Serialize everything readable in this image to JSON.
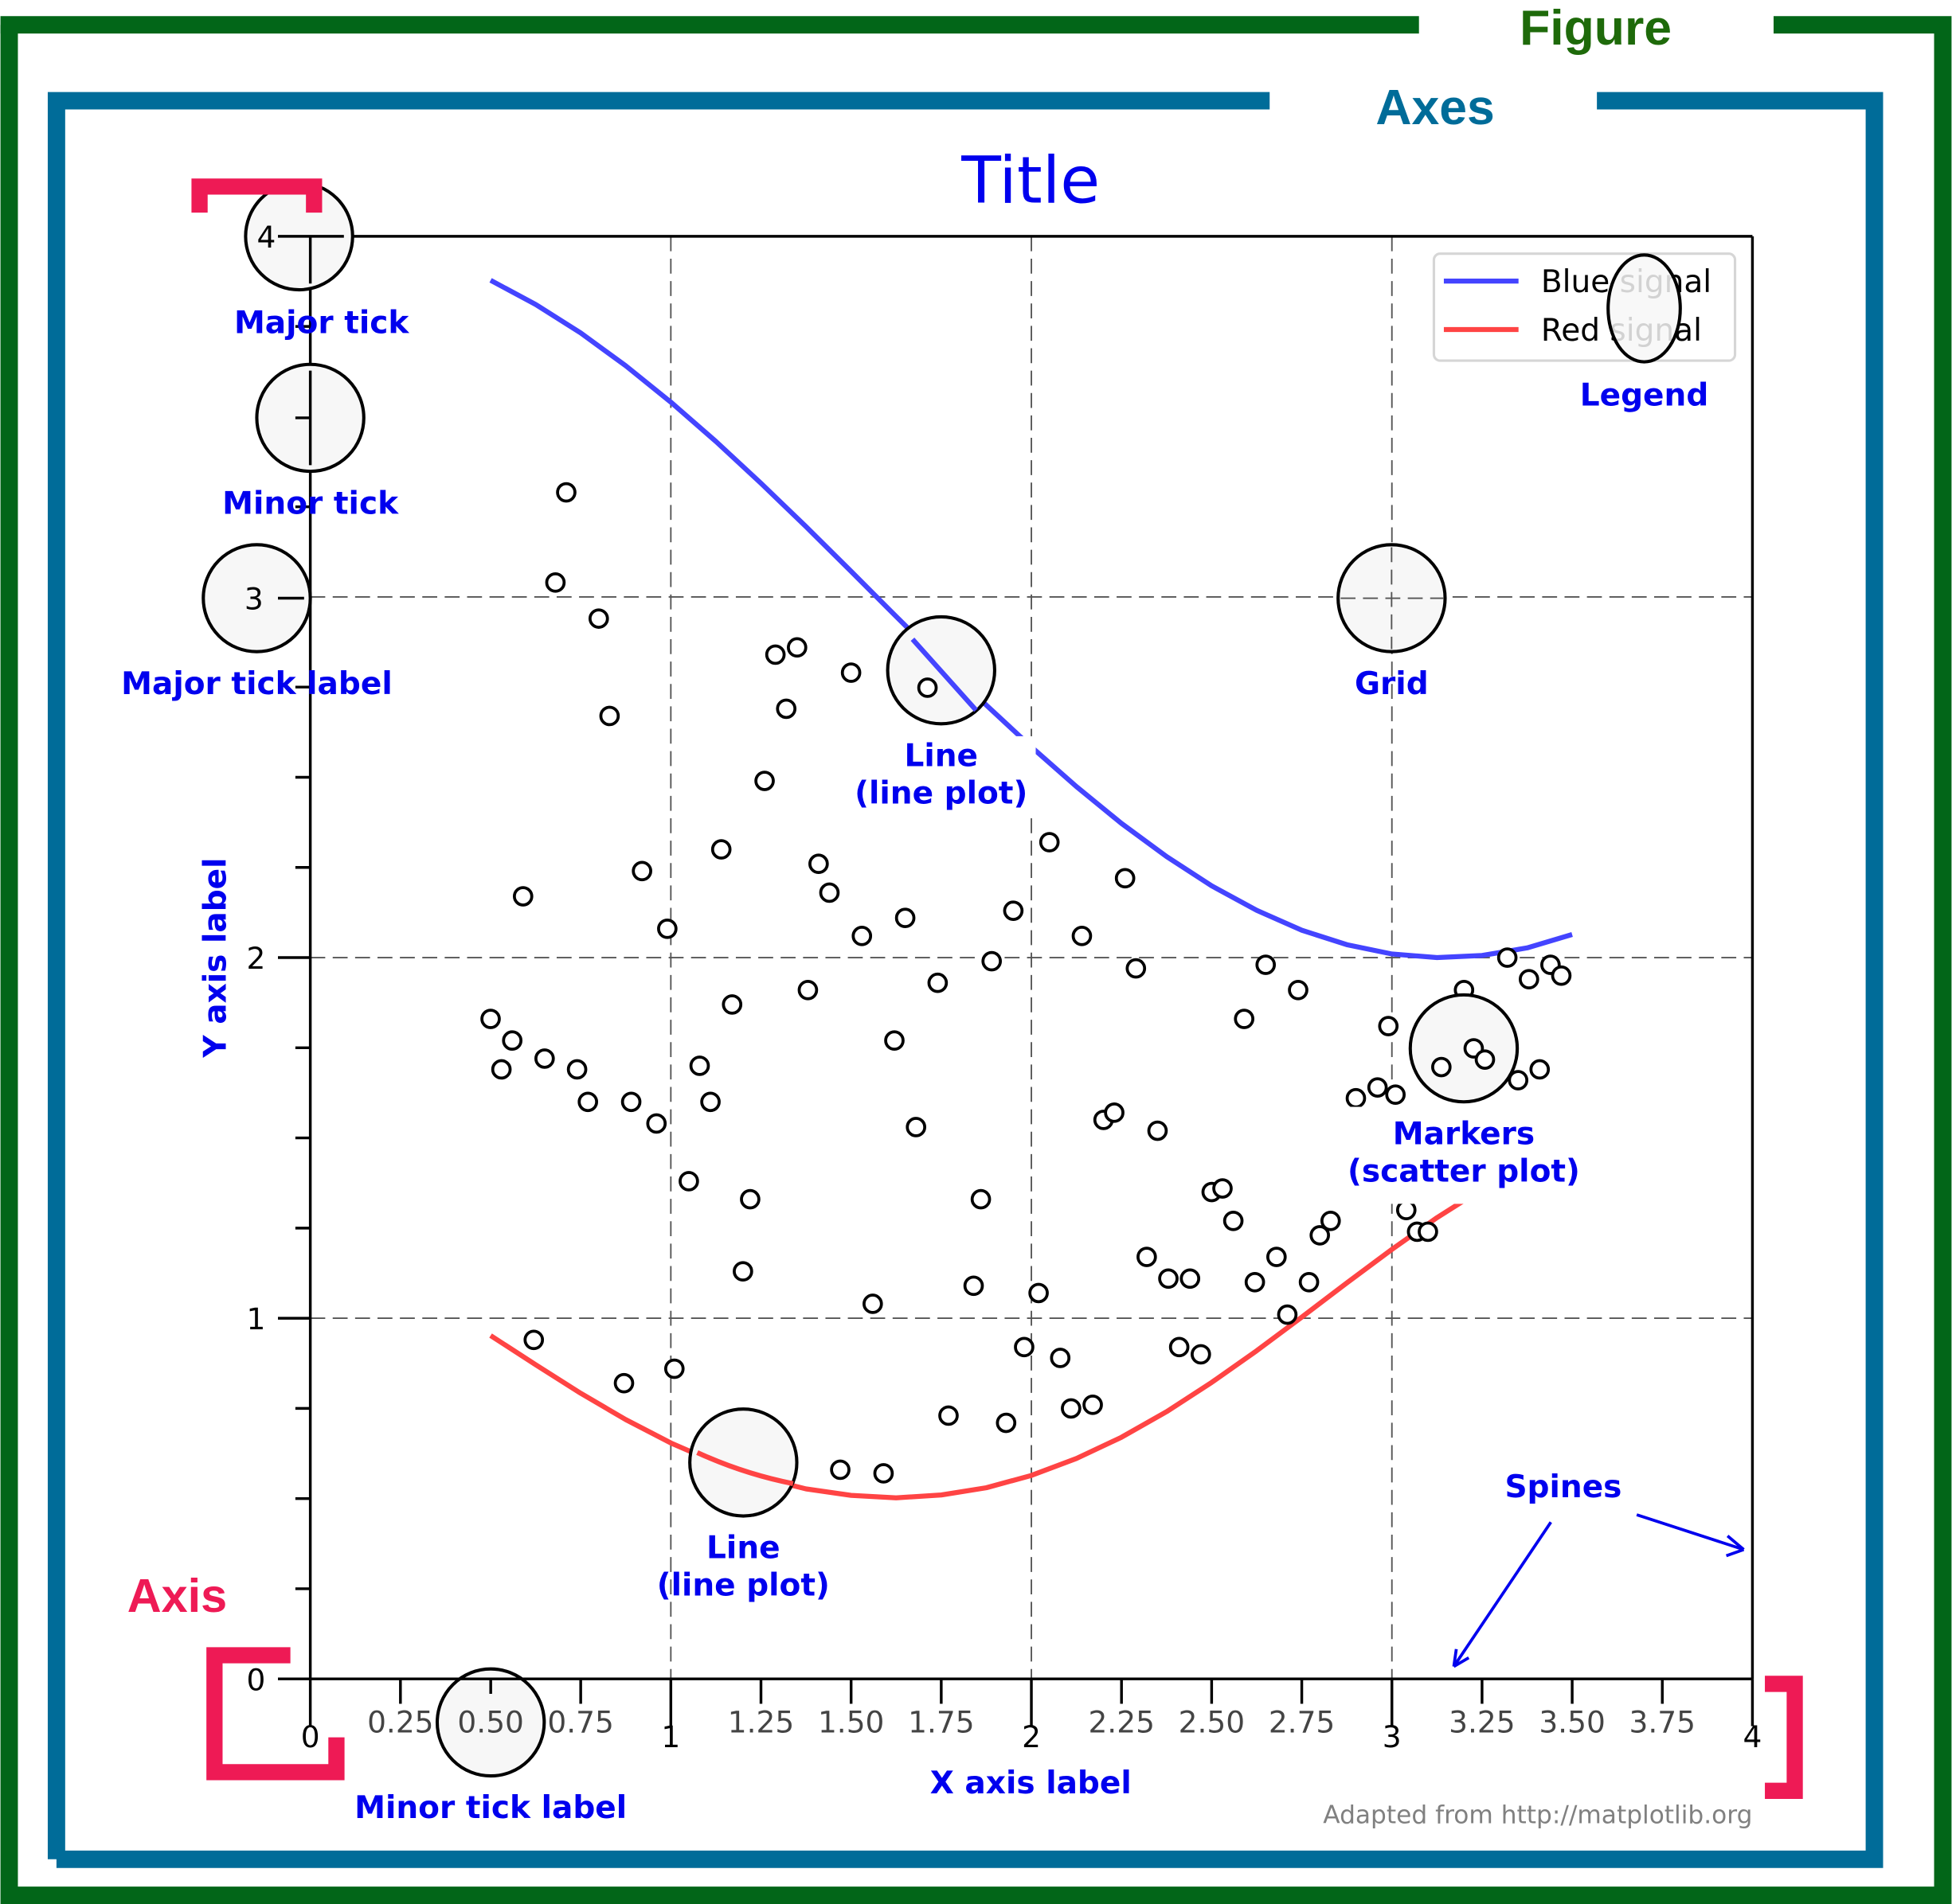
{
  "figure": {
    "figure_label": "Figure",
    "axes_label": "Axes",
    "axis_label": "Axis",
    "attribution": "Adapted from http://matplotlib.org",
    "colors": {
      "figure_frame": "#026618",
      "axes_frame": "#006c99",
      "axis_bracket": "#ee1a55",
      "annotation_text": "#0000ee",
      "blue_signal": "#4444ff",
      "red_signal": "#ff4444"
    }
  },
  "annotations": {
    "major_tick": "Major tick",
    "minor_tick": "Minor tick",
    "major_tick_label": "Major tick label",
    "minor_tick_label": "Minor tick label",
    "grid": "Grid",
    "legend": "Legend",
    "line_plot_top_1": "Line",
    "line_plot_top_2": "(line plot)",
    "line_plot_bottom_1": "Line",
    "line_plot_bottom_2": "(line plot)",
    "markers_1": "Markers",
    "markers_2": "(scatter plot)",
    "spines": "Spines"
  },
  "chart_data": {
    "type": "line",
    "title": "Title",
    "xlabel": "X axis label",
    "ylabel": "Y axis label",
    "xlim": [
      0,
      4
    ],
    "ylim": [
      0,
      4
    ],
    "grid": true,
    "legend_position": "top-right",
    "x_major_ticks": [
      0,
      1,
      2,
      3,
      4
    ],
    "x_major_tick_labels": [
      "0",
      "1",
      "2",
      "3",
      "4"
    ],
    "x_minor_ticks": [
      0.25,
      0.5,
      0.75,
      1.25,
      1.5,
      1.75,
      2.25,
      2.5,
      2.75,
      3.25,
      3.5,
      3.75
    ],
    "x_minor_tick_labels": [
      "0.25",
      "0.50",
      "0.75",
      "1.25",
      "1.50",
      "1.75",
      "2.25",
      "2.50",
      "2.75",
      "3.25",
      "3.50",
      "3.75"
    ],
    "y_major_ticks": [
      0,
      1,
      2,
      3,
      4
    ],
    "y_major_tick_labels": [
      "0",
      "1",
      "2",
      "3",
      "4"
    ],
    "y_minor_ticks": [
      0.25,
      0.5,
      0.75,
      1.25,
      1.5,
      1.75,
      2.25,
      2.5,
      2.75,
      3.25,
      3.5,
      3.75
    ],
    "series": [
      {
        "name": "Blue signal",
        "type": "line",
        "color": "#4444ff",
        "x": [
          0.5,
          0.625,
          0.75,
          0.875,
          1.0,
          1.125,
          1.25,
          1.375,
          1.5,
          1.625,
          1.75,
          1.875,
          2.0,
          2.125,
          2.25,
          2.375,
          2.5,
          2.625,
          2.75,
          2.875,
          3.0,
          3.125,
          3.25,
          3.375,
          3.5
        ],
        "y": [
          3.878,
          3.811,
          3.732,
          3.641,
          3.54,
          3.431,
          3.315,
          3.195,
          3.071,
          2.946,
          2.822,
          2.7,
          2.584,
          2.474,
          2.372,
          2.28,
          2.199,
          2.131,
          2.076,
          2.036,
          2.01,
          2.0,
          2.006,
          2.027,
          2.064
        ]
      },
      {
        "name": "Red signal",
        "type": "line",
        "color": "#ff4444",
        "x": [
          0.5,
          0.625,
          0.75,
          0.875,
          1.0,
          1.125,
          1.25,
          1.375,
          1.5,
          1.625,
          1.75,
          1.875,
          2.0,
          2.125,
          2.25,
          2.375,
          2.5,
          2.625,
          2.75,
          2.875,
          3.0,
          3.125,
          3.25,
          3.375,
          3.5
        ],
        "y": [
          0.952,
          0.871,
          0.792,
          0.719,
          0.654,
          0.6,
          0.558,
          0.527,
          0.509,
          0.502,
          0.51,
          0.53,
          0.564,
          0.611,
          0.67,
          0.741,
          0.822,
          0.91,
          1.003,
          1.098,
          1.191,
          1.279,
          1.358,
          1.424,
          1.475
        ]
      },
      {
        "name": "Markers",
        "type": "scatter",
        "points": [
          [
            0.71,
            3.29
          ],
          [
            0.68,
            3.04
          ],
          [
            0.8,
            2.94
          ],
          [
            0.83,
            2.67
          ],
          [
            0.59,
            2.17
          ],
          [
            0.5,
            1.83
          ],
          [
            0.56,
            1.77
          ],
          [
            0.53,
            1.69
          ],
          [
            0.65,
            1.72
          ],
          [
            0.74,
            1.69
          ],
          [
            0.77,
            1.6
          ],
          [
            0.89,
            1.6
          ],
          [
            0.96,
            1.54
          ],
          [
            0.92,
            2.24
          ],
          [
            0.99,
            2.08
          ],
          [
            1.05,
            1.38
          ],
          [
            1.08,
            1.7
          ],
          [
            1.11,
            1.6
          ],
          [
            1.14,
            2.3
          ],
          [
            1.17,
            1.87
          ],
          [
            1.29,
            2.84
          ],
          [
            1.35,
            2.86
          ],
          [
            1.32,
            2.69
          ],
          [
            1.26,
            2.49
          ],
          [
            1.5,
            2.79
          ],
          [
            1.41,
            2.26
          ],
          [
            1.44,
            2.18
          ],
          [
            1.38,
            1.91
          ],
          [
            1.53,
            2.06
          ],
          [
            1.65,
            2.11
          ],
          [
            1.62,
            1.77
          ],
          [
            1.68,
            1.53
          ],
          [
            1.71,
            2.75
          ],
          [
            1.74,
            1.93
          ],
          [
            1.22,
            1.33
          ],
          [
            1.2,
            1.13
          ],
          [
            1.86,
            1.33
          ],
          [
            1.84,
            1.09
          ],
          [
            1.56,
            1.04
          ],
          [
            2.05,
            2.32
          ],
          [
            1.95,
            2.13
          ],
          [
            1.89,
            1.99
          ],
          [
            2.14,
            2.06
          ],
          [
            2.26,
            2.22
          ],
          [
            2.29,
            1.97
          ],
          [
            2.2,
            1.55
          ],
          [
            2.23,
            1.57
          ],
          [
            2.35,
            1.52
          ],
          [
            0.62,
            0.94
          ],
          [
            0.87,
            0.82
          ],
          [
            1.01,
            0.86
          ],
          [
            1.47,
            0.58
          ],
          [
            1.59,
            0.57
          ],
          [
            1.77,
            0.73
          ],
          [
            1.93,
            0.71
          ],
          [
            2.02,
            1.07
          ],
          [
            1.98,
            0.92
          ],
          [
            2.08,
            0.89
          ],
          [
            2.11,
            0.75
          ],
          [
            2.17,
            0.76
          ],
          [
            2.32,
            1.17
          ],
          [
            2.38,
            1.11
          ],
          [
            2.44,
            1.11
          ],
          [
            2.41,
            0.92
          ],
          [
            2.47,
            0.9
          ],
          [
            2.5,
            1.35
          ],
          [
            2.53,
            1.36
          ],
          [
            2.56,
            1.27
          ],
          [
            2.62,
            1.1
          ],
          [
            2.68,
            1.17
          ],
          [
            2.71,
            1.01
          ],
          [
            2.77,
            1.1
          ],
          [
            2.8,
            1.23
          ],
          [
            2.83,
            1.27
          ],
          [
            2.59,
            1.83
          ],
          [
            2.65,
            1.98
          ],
          [
            2.74,
            1.91
          ],
          [
            2.9,
            1.61
          ],
          [
            2.96,
            1.64
          ],
          [
            3.01,
            1.62
          ],
          [
            2.99,
            1.81
          ],
          [
            3.04,
            1.3
          ],
          [
            3.07,
            1.24
          ],
          [
            3.1,
            1.24
          ],
          [
            3.2,
            1.91
          ],
          [
            3.14,
            1.7
          ],
          [
            3.23,
            1.75
          ],
          [
            3.26,
            1.72
          ],
          [
            3.35,
            1.66
          ],
          [
            3.32,
            2.0
          ],
          [
            3.38,
            1.94
          ],
          [
            3.44,
            1.98
          ],
          [
            3.47,
            1.95
          ],
          [
            3.41,
            1.69
          ]
        ]
      }
    ],
    "legend": [
      "Blue signal",
      "Red signal"
    ]
  }
}
